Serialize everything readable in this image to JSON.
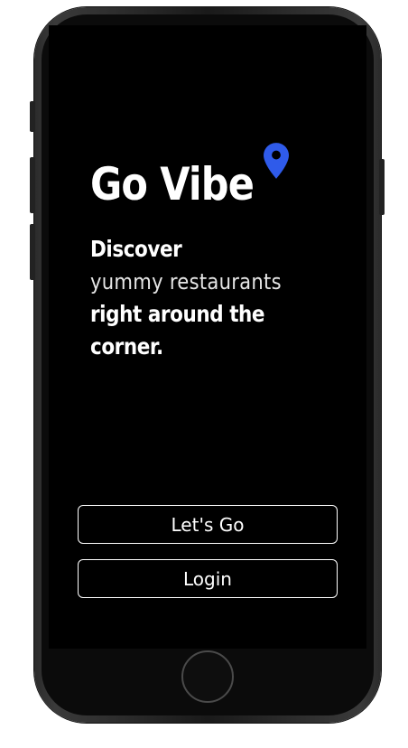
{
  "app": {
    "title": "Go Vibe"
  },
  "tagline": {
    "line1": "Discover",
    "line2": "yummy restaurants",
    "line3": "right around the",
    "line4": "corner."
  },
  "actions": {
    "primary_label": "Let's Go",
    "secondary_label": "Login"
  },
  "icons": {
    "location": "map-pin-icon"
  },
  "colors": {
    "background": "#000000",
    "text": "#ffffff",
    "accent": "#2f5bea"
  }
}
